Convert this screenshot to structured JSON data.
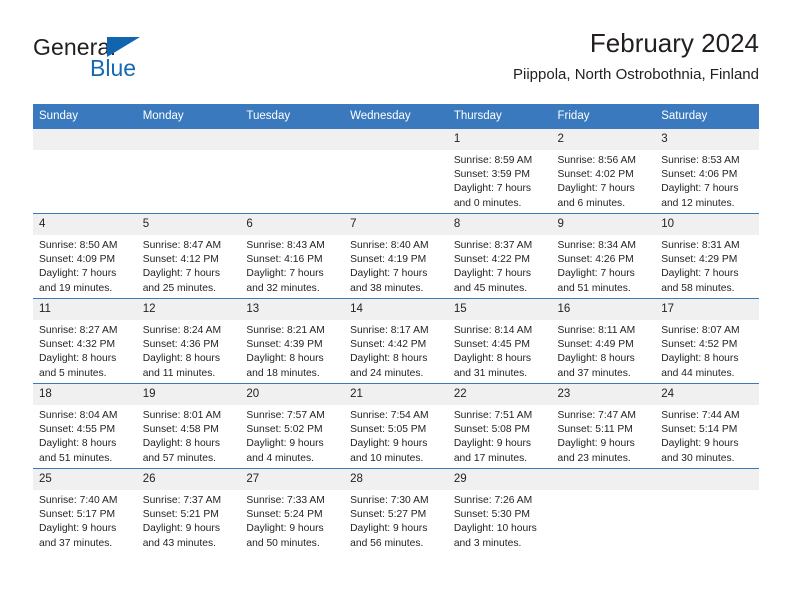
{
  "brand": {
    "name_part1": "General",
    "name_part2": "Blue",
    "logo_icon": "triangle-flag-icon",
    "accent_color": "#1066ae"
  },
  "header": {
    "title": "February 2024",
    "subtitle": "Piippola, North Ostrobothnia, Finland"
  },
  "calendar": {
    "header_bg": "#3a79bd",
    "daynum_bg": "#f0f0f0",
    "weekday_headers": [
      "Sunday",
      "Monday",
      "Tuesday",
      "Wednesday",
      "Thursday",
      "Friday",
      "Saturday"
    ],
    "weeks": [
      [
        {
          "day": "",
          "lines": []
        },
        {
          "day": "",
          "lines": []
        },
        {
          "day": "",
          "lines": []
        },
        {
          "day": "",
          "lines": []
        },
        {
          "day": "1",
          "lines": [
            "Sunrise: 8:59 AM",
            "Sunset: 3:59 PM",
            "Daylight: 7 hours",
            "and 0 minutes."
          ]
        },
        {
          "day": "2",
          "lines": [
            "Sunrise: 8:56 AM",
            "Sunset: 4:02 PM",
            "Daylight: 7 hours",
            "and 6 minutes."
          ]
        },
        {
          "day": "3",
          "lines": [
            "Sunrise: 8:53 AM",
            "Sunset: 4:06 PM",
            "Daylight: 7 hours",
            "and 12 minutes."
          ]
        }
      ],
      [
        {
          "day": "4",
          "lines": [
            "Sunrise: 8:50 AM",
            "Sunset: 4:09 PM",
            "Daylight: 7 hours",
            "and 19 minutes."
          ]
        },
        {
          "day": "5",
          "lines": [
            "Sunrise: 8:47 AM",
            "Sunset: 4:12 PM",
            "Daylight: 7 hours",
            "and 25 minutes."
          ]
        },
        {
          "day": "6",
          "lines": [
            "Sunrise: 8:43 AM",
            "Sunset: 4:16 PM",
            "Daylight: 7 hours",
            "and 32 minutes."
          ]
        },
        {
          "day": "7",
          "lines": [
            "Sunrise: 8:40 AM",
            "Sunset: 4:19 PM",
            "Daylight: 7 hours",
            "and 38 minutes."
          ]
        },
        {
          "day": "8",
          "lines": [
            "Sunrise: 8:37 AM",
            "Sunset: 4:22 PM",
            "Daylight: 7 hours",
            "and 45 minutes."
          ]
        },
        {
          "day": "9",
          "lines": [
            "Sunrise: 8:34 AM",
            "Sunset: 4:26 PM",
            "Daylight: 7 hours",
            "and 51 minutes."
          ]
        },
        {
          "day": "10",
          "lines": [
            "Sunrise: 8:31 AM",
            "Sunset: 4:29 PM",
            "Daylight: 7 hours",
            "and 58 minutes."
          ]
        }
      ],
      [
        {
          "day": "11",
          "lines": [
            "Sunrise: 8:27 AM",
            "Sunset: 4:32 PM",
            "Daylight: 8 hours",
            "and 5 minutes."
          ]
        },
        {
          "day": "12",
          "lines": [
            "Sunrise: 8:24 AM",
            "Sunset: 4:36 PM",
            "Daylight: 8 hours",
            "and 11 minutes."
          ]
        },
        {
          "day": "13",
          "lines": [
            "Sunrise: 8:21 AM",
            "Sunset: 4:39 PM",
            "Daylight: 8 hours",
            "and 18 minutes."
          ]
        },
        {
          "day": "14",
          "lines": [
            "Sunrise: 8:17 AM",
            "Sunset: 4:42 PM",
            "Daylight: 8 hours",
            "and 24 minutes."
          ]
        },
        {
          "day": "15",
          "lines": [
            "Sunrise: 8:14 AM",
            "Sunset: 4:45 PM",
            "Daylight: 8 hours",
            "and 31 minutes."
          ]
        },
        {
          "day": "16",
          "lines": [
            "Sunrise: 8:11 AM",
            "Sunset: 4:49 PM",
            "Daylight: 8 hours",
            "and 37 minutes."
          ]
        },
        {
          "day": "17",
          "lines": [
            "Sunrise: 8:07 AM",
            "Sunset: 4:52 PM",
            "Daylight: 8 hours",
            "and 44 minutes."
          ]
        }
      ],
      [
        {
          "day": "18",
          "lines": [
            "Sunrise: 8:04 AM",
            "Sunset: 4:55 PM",
            "Daylight: 8 hours",
            "and 51 minutes."
          ]
        },
        {
          "day": "19",
          "lines": [
            "Sunrise: 8:01 AM",
            "Sunset: 4:58 PM",
            "Daylight: 8 hours",
            "and 57 minutes."
          ]
        },
        {
          "day": "20",
          "lines": [
            "Sunrise: 7:57 AM",
            "Sunset: 5:02 PM",
            "Daylight: 9 hours",
            "and 4 minutes."
          ]
        },
        {
          "day": "21",
          "lines": [
            "Sunrise: 7:54 AM",
            "Sunset: 5:05 PM",
            "Daylight: 9 hours",
            "and 10 minutes."
          ]
        },
        {
          "day": "22",
          "lines": [
            "Sunrise: 7:51 AM",
            "Sunset: 5:08 PM",
            "Daylight: 9 hours",
            "and 17 minutes."
          ]
        },
        {
          "day": "23",
          "lines": [
            "Sunrise: 7:47 AM",
            "Sunset: 5:11 PM",
            "Daylight: 9 hours",
            "and 23 minutes."
          ]
        },
        {
          "day": "24",
          "lines": [
            "Sunrise: 7:44 AM",
            "Sunset: 5:14 PM",
            "Daylight: 9 hours",
            "and 30 minutes."
          ]
        }
      ],
      [
        {
          "day": "25",
          "lines": [
            "Sunrise: 7:40 AM",
            "Sunset: 5:17 PM",
            "Daylight: 9 hours",
            "and 37 minutes."
          ]
        },
        {
          "day": "26",
          "lines": [
            "Sunrise: 7:37 AM",
            "Sunset: 5:21 PM",
            "Daylight: 9 hours",
            "and 43 minutes."
          ]
        },
        {
          "day": "27",
          "lines": [
            "Sunrise: 7:33 AM",
            "Sunset: 5:24 PM",
            "Daylight: 9 hours",
            "and 50 minutes."
          ]
        },
        {
          "day": "28",
          "lines": [
            "Sunrise: 7:30 AM",
            "Sunset: 5:27 PM",
            "Daylight: 9 hours",
            "and 56 minutes."
          ]
        },
        {
          "day": "29",
          "lines": [
            "Sunrise: 7:26 AM",
            "Sunset: 5:30 PM",
            "Daylight: 10 hours",
            "and 3 minutes."
          ]
        },
        {
          "day": "",
          "lines": []
        },
        {
          "day": "",
          "lines": []
        }
      ]
    ]
  }
}
